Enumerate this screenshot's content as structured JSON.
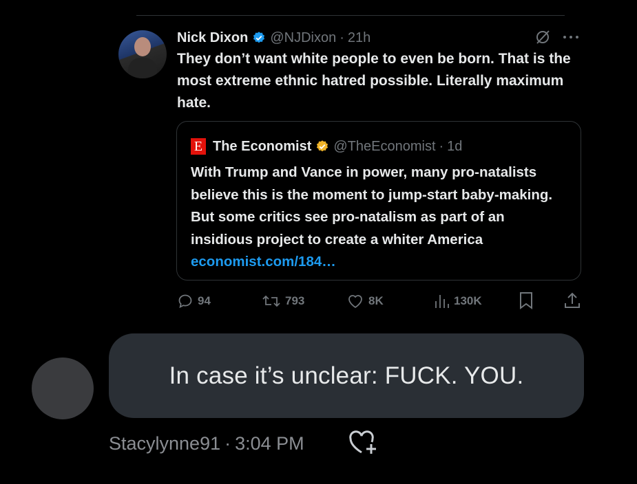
{
  "tweet": {
    "author_name": "Nick Dixon",
    "handle": "@NJDixon",
    "separator": "·",
    "time": "21h",
    "text": "They don’t want white people to even be born. That is the most extreme ethnic hatred possible. Literally maximum hate.",
    "verified_color": "#1d9bf0",
    "icons": [
      "grok-icon",
      "more-icon"
    ]
  },
  "quote": {
    "logo_letter": "E",
    "logo_color": "#e3120b",
    "author_name": "The Economist",
    "handle": "@TheEconomist",
    "separator": "·",
    "time": "1d",
    "verified_color": "#f0b429",
    "text": "With Trump and Vance in power, many pro-natalists believe this is the moment to jump-start baby-making. But some critics see pro-natalism as part of an insidious project to create a whiter America",
    "link": "economist.com/184…"
  },
  "actions": {
    "replies": "94",
    "retweets": "793",
    "likes": "8K",
    "views": "130K",
    "icons": [
      "reply-icon",
      "retweet-icon",
      "like-icon",
      "views-icon",
      "bookmark-icon",
      "share-icon"
    ]
  },
  "message": {
    "text": "In case it’s unclear: FUCK. YOU.",
    "sender": "Stacylynne91",
    "separator": "·",
    "time": "3:04 PM",
    "bubble_color": "#2a2f35",
    "icon": "heart-plus-icon"
  }
}
